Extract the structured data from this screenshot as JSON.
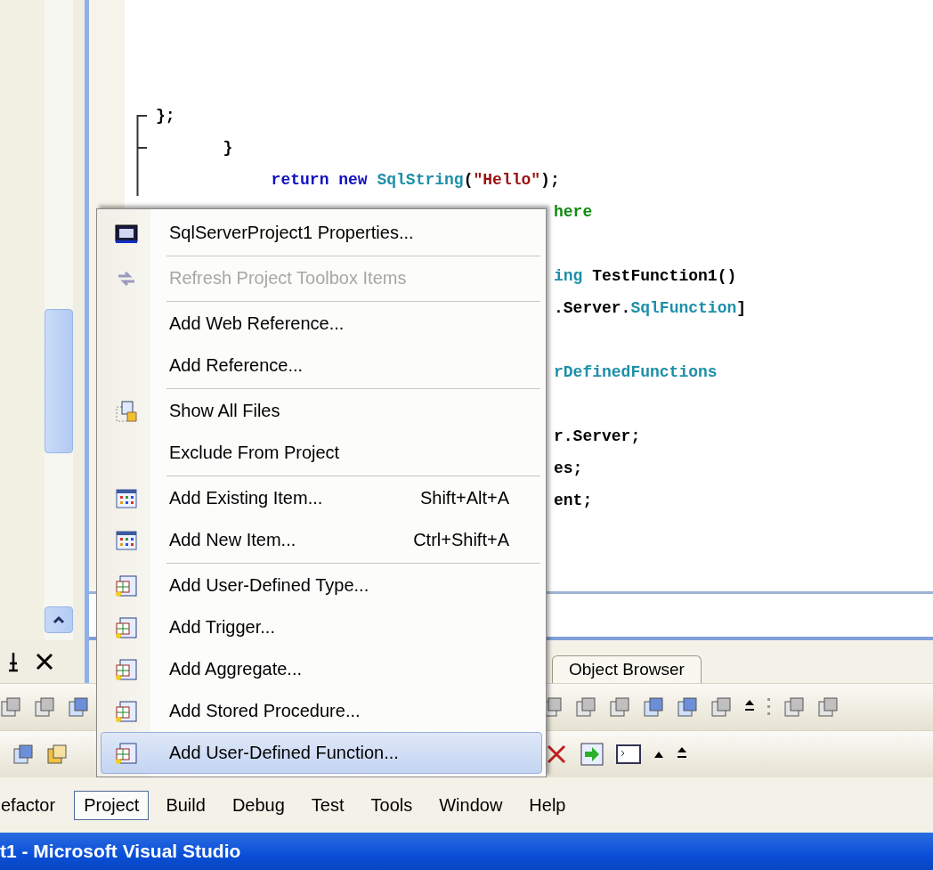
{
  "code_blocks": [
    [
      {
        "kind": "full",
        "tokens": [
          {
            "text": "};",
            "kind": "plain"
          }
        ]
      },
      {
        "kind": "full",
        "tokens": [
          {
            "text": "       }",
            "kind": "plain"
          }
        ]
      },
      {
        "kind": "full",
        "tokens": [
          {
            "text": "            return new",
            "kind": "keyword"
          },
          {
            "text": " SqlString",
            "kind": "type"
          },
          {
            "text": "(",
            "kind": "plain"
          },
          {
            "text": "\"Hello\"",
            "kind": "string"
          },
          {
            "text": ");",
            "kind": "plain"
          }
        ]
      },
      {
        "kind": "partial",
        "tokens": [
          {
            "text": "here",
            "kind": "comment"
          }
        ]
      }
    ],
    [
      {
        "kind": "partial",
        "tokens": [
          {
            "text": "ing",
            "kind": "type"
          },
          {
            "text": " TestFunction1()",
            "kind": "plain"
          }
        ]
      },
      {
        "kind": "partial",
        "tokens": [
          {
            "text": ".Server.",
            "kind": "plain"
          },
          {
            "text": "SqlFunction",
            "kind": "type"
          },
          {
            "text": "]",
            "kind": "plain"
          }
        ]
      }
    ],
    [
      {
        "kind": "partial",
        "tokens": [
          {
            "text": "rDefinedFunctions",
            "kind": "type"
          }
        ]
      }
    ],
    [
      {
        "kind": "partial",
        "tokens": [
          {
            "text": "r.Server;",
            "kind": "plain"
          }
        ]
      },
      {
        "kind": "partial",
        "tokens": [
          {
            "text": "es;",
            "kind": "plain"
          }
        ]
      },
      {
        "kind": "partial",
        "tokens": [
          {
            "text": "ent;",
            "kind": "plain"
          }
        ]
      }
    ]
  ],
  "project_menu": [
    [
      {
        "label": "SqlServerProject1 Properties...",
        "kind": "properties",
        "selected": false,
        "disabled": false
      }
    ],
    [
      {
        "label": "Refresh Project Toolbox Items",
        "kind": "refresh",
        "selected": false,
        "disabled": true
      }
    ],
    [
      {
        "label": "Add Web Reference...",
        "kind": "plain",
        "selected": false,
        "disabled": false
      },
      {
        "label": "Add Reference...",
        "kind": "plain",
        "selected": false,
        "disabled": false
      }
    ],
    [
      {
        "label": "Show All Files",
        "kind": "files",
        "selected": false,
        "disabled": false
      },
      {
        "label": "Exclude From Project",
        "kind": "plain",
        "selected": false,
        "disabled": false
      }
    ],
    [
      {
        "label": "Add Existing Item...",
        "shortcut": "Shift+Alt+A",
        "kind": "item",
        "selected": false,
        "disabled": false
      },
      {
        "label": "Add New Item...",
        "shortcut": "Ctrl+Shift+A",
        "kind": "item",
        "selected": false,
        "disabled": false
      }
    ],
    [
      {
        "label": "Add User-Defined Type...",
        "kind": "object",
        "selected": false,
        "disabled": false
      },
      {
        "label": "Add Trigger...",
        "kind": "object",
        "selected": false,
        "disabled": false
      },
      {
        "label": "Add Aggregate...",
        "kind": "object",
        "selected": false,
        "disabled": false
      },
      {
        "label": "Add Stored Procedure...",
        "kind": "object",
        "selected": false,
        "disabled": false
      },
      {
        "label": "Add User-Defined Function...",
        "kind": "object",
        "selected": true,
        "disabled": false
      }
    ]
  ],
  "document_tabs": [
    {
      "label": "Object Browser",
      "selected": false
    }
  ],
  "menu_bar": [
    {
      "label": "efactor",
      "selected": false
    },
    {
      "label": "Project",
      "selected": true
    },
    {
      "label": "Build",
      "selected": false
    },
    {
      "label": "Debug",
      "selected": false
    },
    {
      "label": "Test",
      "selected": false
    },
    {
      "label": "Tools",
      "selected": false
    },
    {
      "label": "Window",
      "selected": false
    },
    {
      "label": "Help",
      "selected": false
    }
  ],
  "window": {
    "title": "t1 - Microsoft Visual Studio"
  }
}
